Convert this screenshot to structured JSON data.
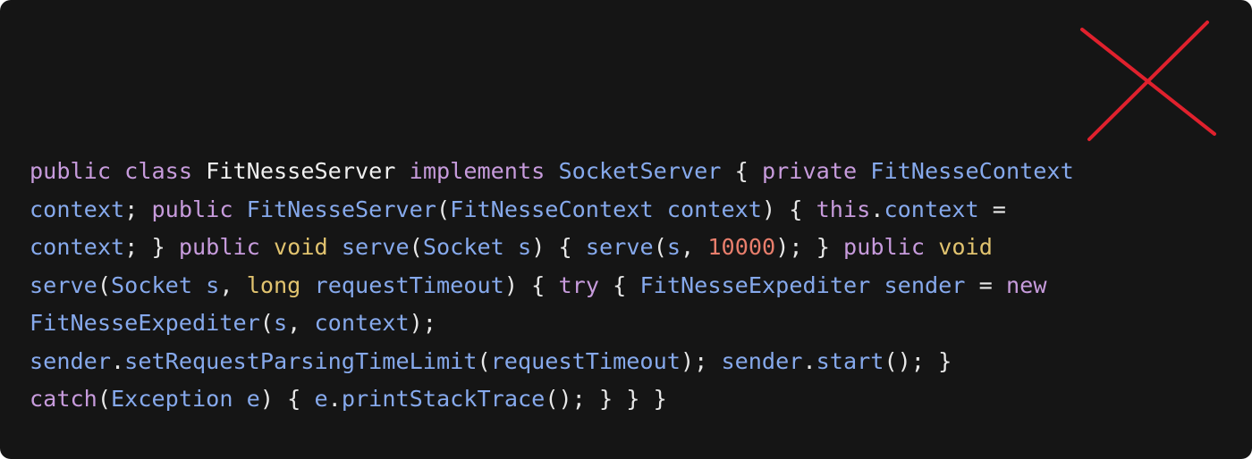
{
  "colors": {
    "background": "#151515",
    "keyword": "#c79bdc",
    "type": "#86a9ec",
    "identifier": "#86a9ec",
    "primitive": "#e1c36f",
    "number": "#e87e6c",
    "punctuation": "#e8e8e8",
    "class_name": "#f0f0f0",
    "cross_mark": "#e0212d"
  },
  "icons": {
    "cross": "red-x-cross-icon"
  },
  "code": {
    "lines": [
      [
        {
          "t": "public",
          "c": "kw"
        },
        {
          "t": " ",
          "c": "punc"
        },
        {
          "t": "class",
          "c": "kw"
        },
        {
          "t": " ",
          "c": "punc"
        },
        {
          "t": "FitNesseServer",
          "c": "cls"
        },
        {
          "t": " ",
          "c": "punc"
        },
        {
          "t": "implements",
          "c": "kw"
        },
        {
          "t": " ",
          "c": "punc"
        },
        {
          "t": "SocketServer",
          "c": "type"
        },
        {
          "t": " { ",
          "c": "punc"
        },
        {
          "t": "private",
          "c": "kw"
        },
        {
          "t": " ",
          "c": "punc"
        },
        {
          "t": "FitNesseContext",
          "c": "type"
        }
      ],
      [
        {
          "t": "context",
          "c": "id"
        },
        {
          "t": "; ",
          "c": "punc"
        },
        {
          "t": "public",
          "c": "kw"
        },
        {
          "t": " ",
          "c": "punc"
        },
        {
          "t": "FitNesseServer",
          "c": "fn"
        },
        {
          "t": "(",
          "c": "punc"
        },
        {
          "t": "FitNesseContext",
          "c": "type"
        },
        {
          "t": " ",
          "c": "punc"
        },
        {
          "t": "context",
          "c": "id"
        },
        {
          "t": ") { ",
          "c": "punc"
        },
        {
          "t": "this",
          "c": "kw"
        },
        {
          "t": ".",
          "c": "punc"
        },
        {
          "t": "context",
          "c": "id"
        },
        {
          "t": " =",
          "c": "punc"
        }
      ],
      [
        {
          "t": "context",
          "c": "id"
        },
        {
          "t": "; } ",
          "c": "punc"
        },
        {
          "t": "public",
          "c": "kw"
        },
        {
          "t": " ",
          "c": "punc"
        },
        {
          "t": "void",
          "c": "prim"
        },
        {
          "t": " ",
          "c": "punc"
        },
        {
          "t": "serve",
          "c": "fn"
        },
        {
          "t": "(",
          "c": "punc"
        },
        {
          "t": "Socket",
          "c": "type"
        },
        {
          "t": " ",
          "c": "punc"
        },
        {
          "t": "s",
          "c": "id"
        },
        {
          "t": ") { ",
          "c": "punc"
        },
        {
          "t": "serve",
          "c": "fn"
        },
        {
          "t": "(",
          "c": "punc"
        },
        {
          "t": "s",
          "c": "id"
        },
        {
          "t": ", ",
          "c": "punc"
        },
        {
          "t": "10000",
          "c": "num"
        },
        {
          "t": "); } ",
          "c": "punc"
        },
        {
          "t": "public",
          "c": "kw"
        },
        {
          "t": " ",
          "c": "punc"
        },
        {
          "t": "void",
          "c": "prim"
        }
      ],
      [
        {
          "t": "serve",
          "c": "fn"
        },
        {
          "t": "(",
          "c": "punc"
        },
        {
          "t": "Socket",
          "c": "type"
        },
        {
          "t": " ",
          "c": "punc"
        },
        {
          "t": "s",
          "c": "id"
        },
        {
          "t": ", ",
          "c": "punc"
        },
        {
          "t": "long",
          "c": "prim"
        },
        {
          "t": " ",
          "c": "punc"
        },
        {
          "t": "requestTimeout",
          "c": "id"
        },
        {
          "t": ") { ",
          "c": "punc"
        },
        {
          "t": "try",
          "c": "kw"
        },
        {
          "t": " { ",
          "c": "punc"
        },
        {
          "t": "FitNesseExpediter",
          "c": "type"
        },
        {
          "t": " ",
          "c": "punc"
        },
        {
          "t": "sender",
          "c": "id"
        },
        {
          "t": " = ",
          "c": "punc"
        },
        {
          "t": "new",
          "c": "kw"
        }
      ],
      [
        {
          "t": "FitNesseExpediter",
          "c": "fn"
        },
        {
          "t": "(",
          "c": "punc"
        },
        {
          "t": "s",
          "c": "id"
        },
        {
          "t": ", ",
          "c": "punc"
        },
        {
          "t": "context",
          "c": "id"
        },
        {
          "t": ");",
          "c": "punc"
        }
      ],
      [
        {
          "t": "sender",
          "c": "id"
        },
        {
          "t": ".",
          "c": "punc"
        },
        {
          "t": "setRequestParsingTimeLimit",
          "c": "fn"
        },
        {
          "t": "(",
          "c": "punc"
        },
        {
          "t": "requestTimeout",
          "c": "id"
        },
        {
          "t": "); ",
          "c": "punc"
        },
        {
          "t": "sender",
          "c": "id"
        },
        {
          "t": ".",
          "c": "punc"
        },
        {
          "t": "start",
          "c": "fn"
        },
        {
          "t": "(); }",
          "c": "punc"
        }
      ],
      [
        {
          "t": "catch",
          "c": "kw"
        },
        {
          "t": "(",
          "c": "punc"
        },
        {
          "t": "Exception",
          "c": "type"
        },
        {
          "t": " ",
          "c": "punc"
        },
        {
          "t": "e",
          "c": "id"
        },
        {
          "t": ") { ",
          "c": "punc"
        },
        {
          "t": "e",
          "c": "id"
        },
        {
          "t": ".",
          "c": "punc"
        },
        {
          "t": "printStackTrace",
          "c": "fn"
        },
        {
          "t": "(); } } }",
          "c": "punc"
        }
      ]
    ]
  }
}
